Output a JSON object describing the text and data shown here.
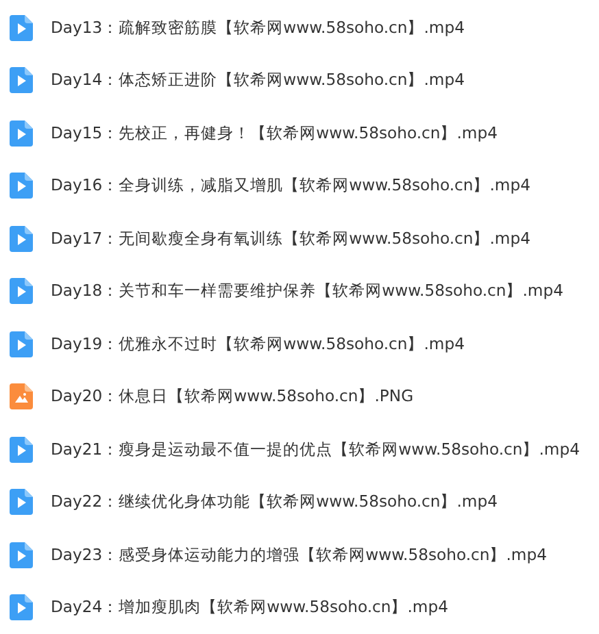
{
  "files": [
    {
      "name": "Day13：疏解致密筋膜【软希网www.58soho.cn】.mp4",
      "kind": "video"
    },
    {
      "name": "Day14：体态矫正进阶【软希网www.58soho.cn】.mp4",
      "kind": "video"
    },
    {
      "name": "Day15：先校正，再健身！【软希网www.58soho.cn】.mp4",
      "kind": "video"
    },
    {
      "name": "Day16：全身训练，减脂又增肌【软希网www.58soho.cn】.mp4",
      "kind": "video"
    },
    {
      "name": "Day17：无间歇瘦全身有氧训练【软希网www.58soho.cn】.mp4",
      "kind": "video"
    },
    {
      "name": "Day18：关节和车一样需要维护保养【软希网www.58soho.cn】.mp4",
      "kind": "video"
    },
    {
      "name": "Day19：优雅永不过时【软希网www.58soho.cn】.mp4",
      "kind": "video"
    },
    {
      "name": "Day20：休息日【软希网www.58soho.cn】.PNG",
      "kind": "image"
    },
    {
      "name": "Day21：瘦身是运动最不值一提的优点【软希网www.58soho.cn】.mp4",
      "kind": "video"
    },
    {
      "name": "Day22：继续优化身体功能【软希网www.58soho.cn】.mp4",
      "kind": "video"
    },
    {
      "name": "Day23：感受身体运动能力的增强【软希网www.58soho.cn】.mp4",
      "kind": "video"
    },
    {
      "name": "Day24：增加瘦肌肉【软希网www.58soho.cn】.mp4",
      "kind": "video"
    }
  ]
}
